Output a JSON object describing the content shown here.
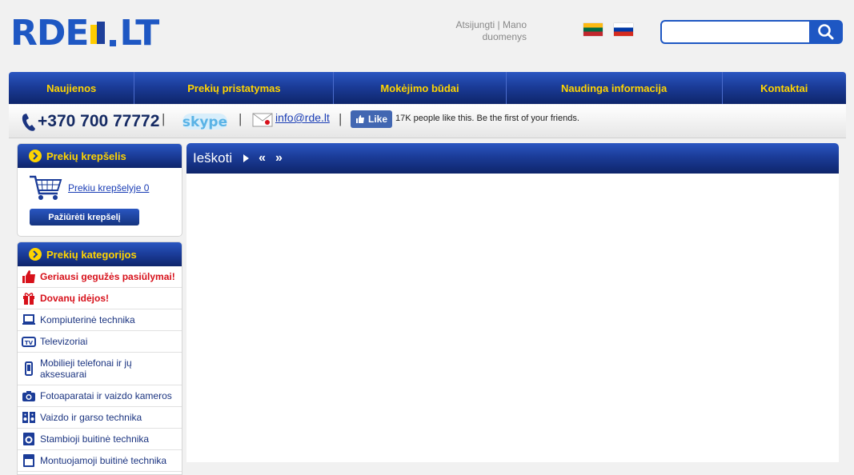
{
  "header": {
    "logo_left": "RDE",
    "logo_right": "LT",
    "account": {
      "logout": "Atsijungti",
      "separator": "|",
      "my_data": "Mano duomenys"
    },
    "search": {
      "placeholder": ""
    }
  },
  "nav": {
    "items": [
      {
        "label": "Naujienos"
      },
      {
        "label": "Prekių pristatymas"
      },
      {
        "label": "Mokėjimo būdai"
      },
      {
        "label": "Naudinga informacija"
      },
      {
        "label": "Kontaktai"
      }
    ]
  },
  "contact": {
    "phone": "+370 700 77772",
    "separator": "|",
    "skype": "skype",
    "email": "info@rde.lt",
    "fb_like": "Like",
    "fb_text": "17K people like this. Be the first of your friends."
  },
  "cart": {
    "title": "Prekių krepšelis",
    "link": "Prekiu krepšelyje 0",
    "button": "Pažiūrėti krepšelį"
  },
  "categories": {
    "title": "Prekių kategorijos",
    "items": [
      {
        "label": "Geriausi gegužės pasiūlymai!",
        "icon": "thumbs-up-icon"
      },
      {
        "label": "Dovanų idėjos!",
        "icon": "gift-icon"
      },
      {
        "label": "Kompiuterinė technika",
        "icon": "laptop-icon"
      },
      {
        "label": "Televizoriai",
        "icon": "tv-icon"
      },
      {
        "label": "Mobilieji telefonai ir jų aksesuarai",
        "icon": "phone-icon"
      },
      {
        "label": "Fotoaparatai ir vaizdo kameros",
        "icon": "camera-icon"
      },
      {
        "label": "Vaizdo ir garso technika",
        "icon": "speaker-icon"
      },
      {
        "label": "Stambioji buitinė technika",
        "icon": "washing-machine-icon"
      },
      {
        "label": "Montuojamoji buitinė technika",
        "icon": "oven-icon"
      }
    ]
  },
  "main": {
    "title": "Ieškoti",
    "prev": "«",
    "next": "»"
  },
  "colors": {
    "brand_blue": "#1e57c3",
    "nav_dark": "#0e256b",
    "accent_yellow": "#ffd400",
    "hot_red": "#d7101a"
  }
}
